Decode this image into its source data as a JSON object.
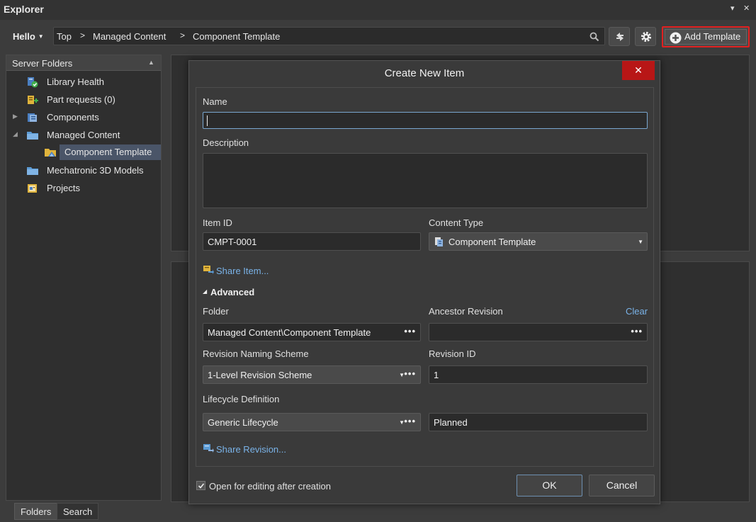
{
  "window": {
    "title": "Explorer",
    "pin": "▾",
    "close": "✕"
  },
  "nav": {
    "hello": "Hello",
    "crumbs": [
      "Top",
      "Managed Content",
      "Component Template"
    ],
    "add_template": "Add Template"
  },
  "tree": {
    "header": "Server Folders",
    "items": [
      {
        "label": "Library Health"
      },
      {
        "label": "Part requests (0)"
      },
      {
        "label": "Components"
      },
      {
        "label": "Managed Content"
      },
      {
        "label": "Component Template"
      },
      {
        "label": "Mechatronic 3D Models"
      },
      {
        "label": "Projects"
      }
    ]
  },
  "bottom_tabs": [
    "Folders",
    "Search"
  ],
  "dialog": {
    "title": "Create New Item",
    "close": "✕",
    "name_label": "Name",
    "name_value": "",
    "description_label": "Description",
    "item_id_label": "Item ID",
    "item_id_value": "CMPT-0001",
    "content_type_label": "Content Type",
    "content_type_value": "Component Template",
    "share_item": "Share Item...",
    "advanced": "Advanced",
    "folder_label": "Folder",
    "folder_value": "Managed Content\\Component Template",
    "ancestor_label": "Ancestor Revision",
    "ancestor_value": "",
    "clear": "Clear",
    "rns_label": "Revision Naming Scheme",
    "rns_value": "1-Level Revision Scheme",
    "revid_label": "Revision ID",
    "revid_value": "1",
    "lifecycle_label": "Lifecycle Definition",
    "lifecycle_value": "Generic Lifecycle",
    "state_value": "Planned",
    "share_revision": "Share Revision...",
    "open_for_editing": "Open for editing after creation",
    "ok": "OK",
    "cancel": "Cancel"
  },
  "colors": {
    "accent_red": "#b81616",
    "link": "#7ab3e8",
    "highlight_border": "#e02020"
  }
}
